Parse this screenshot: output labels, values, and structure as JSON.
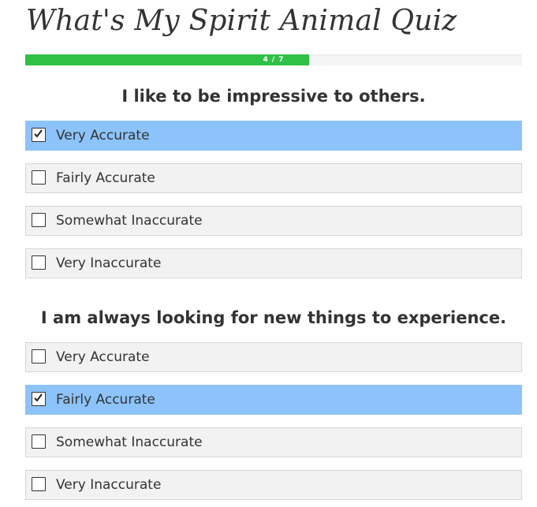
{
  "quiz": {
    "title": "What's My Spirit Animal Quiz"
  },
  "progress": {
    "label": "4 / 7",
    "fraction": 0.571
  },
  "questions": [
    {
      "text": "I like to be impressive to others.",
      "options": [
        {
          "label": "Very Accurate",
          "selected": true
        },
        {
          "label": "Fairly Accurate",
          "selected": false
        },
        {
          "label": "Somewhat Inaccurate",
          "selected": false
        },
        {
          "label": "Very Inaccurate",
          "selected": false
        }
      ]
    },
    {
      "text": "I am always looking for new things to experience.",
      "options": [
        {
          "label": "Very Accurate",
          "selected": false
        },
        {
          "label": "Fairly Accurate",
          "selected": true
        },
        {
          "label": "Somewhat Inaccurate",
          "selected": false
        },
        {
          "label": "Very Inaccurate",
          "selected": false
        }
      ]
    }
  ],
  "colors": {
    "progress_fill": "#2fc046",
    "selected_option": "#8cc3fb",
    "option_background": "#f2f2f2",
    "text": "#333333"
  }
}
